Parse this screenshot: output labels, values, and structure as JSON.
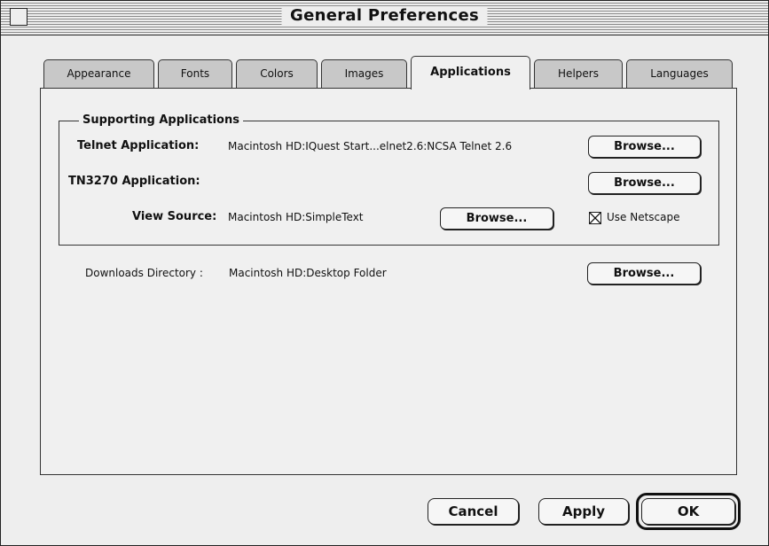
{
  "window": {
    "title": "General Preferences"
  },
  "tabs": [
    {
      "label": "Appearance",
      "active": false
    },
    {
      "label": "Fonts",
      "active": false
    },
    {
      "label": "Colors",
      "active": false
    },
    {
      "label": "Images",
      "active": false
    },
    {
      "label": "Applications",
      "active": true
    },
    {
      "label": "Helpers",
      "active": false
    },
    {
      "label": "Languages",
      "active": false
    }
  ],
  "supporting": {
    "group_title": "Supporting Applications",
    "telnet": {
      "label": "Telnet Application",
      "value": "Macintosh HD:IQuest Start...elnet2.6:NCSA Telnet 2.6",
      "browse": "Browse..."
    },
    "tn3270": {
      "label": "TN3270 Application:",
      "value": "",
      "browse": "Browse..."
    },
    "view_source": {
      "label": "View Source",
      "value": "Macintosh HD:SimpleText",
      "browse": "Browse...",
      "use_netscape_label": "Use Netscape",
      "use_netscape_checked": true
    }
  },
  "downloads": {
    "label": "Downloads Directory",
    "value": "Macintosh HD:Desktop Folder",
    "browse": "Browse..."
  },
  "buttons": {
    "cancel": "Cancel",
    "apply": "Apply",
    "ok": "OK"
  }
}
